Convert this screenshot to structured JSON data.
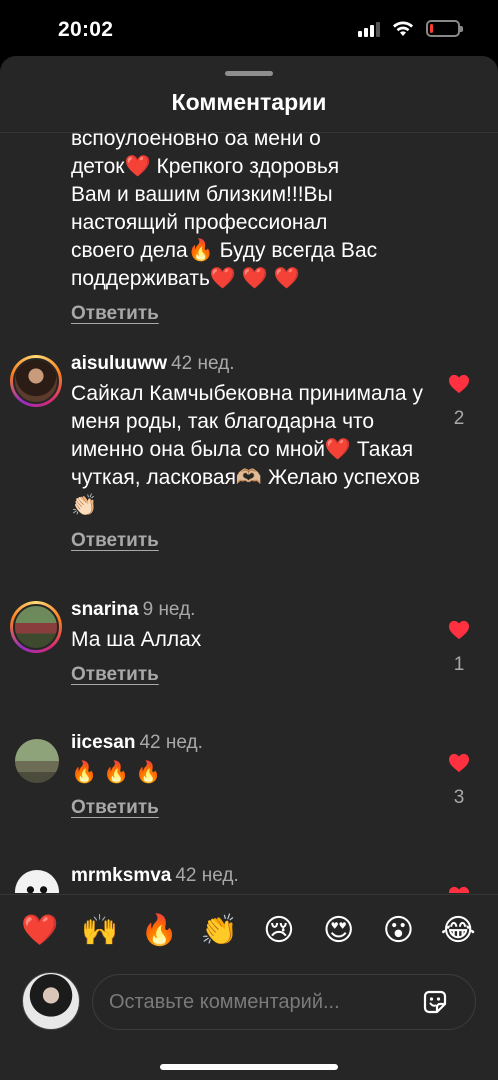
{
  "status": {
    "time": "20:02",
    "battery_level": 0.12
  },
  "sheet": {
    "title": "Комментарии"
  },
  "comments": [
    {
      "partial_text_lines": [
        "вспоулоеновно оа мени о",
        "деток❤️ Крепкого здоровья",
        "Вам и вашим близким!!!Вы",
        "настоящий профессионал",
        "своего дела🔥 Буду всегда Вас",
        "поддерживать❤️ ❤️ ❤️"
      ],
      "reply_label": "Ответить"
    },
    {
      "username": "aisuluuww",
      "time": "42 нед.",
      "text": "Сайкал Камчыбековна принимала у меня роды, так благодарна что именно она была со мной❤️  Такая чуткая, ласковая🫶🏼  Желаю успехов👏🏻",
      "reply_label": "Ответить",
      "likes": "2"
    },
    {
      "username": "snarina",
      "time": "9 нед.",
      "text": "Ма ша Аллах",
      "reply_label": "Ответить",
      "likes": "1"
    },
    {
      "username": "iicesan",
      "time": "42 нед.",
      "text": "🔥 🔥 🔥",
      "reply_label": "Ответить",
      "likes": "3"
    },
    {
      "username": "mrmksmva",
      "time": "42 нед."
    }
  ],
  "emoji_bar": [
    "❤️",
    "🙌",
    "🔥",
    "👏",
    "😢",
    "😍",
    "😮",
    "😂"
  ],
  "composer": {
    "placeholder": "Оставьте комментарий..."
  },
  "colors": {
    "background": "#262626",
    "like": "#ff3040",
    "muted": "#a8a8a8"
  }
}
